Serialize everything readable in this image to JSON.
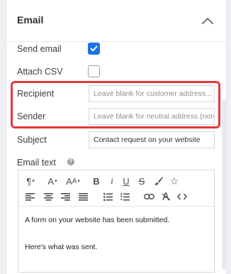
{
  "panel": {
    "title": "Email"
  },
  "fields": {
    "send_email": {
      "label": "Send email",
      "checked": true
    },
    "attach_csv": {
      "label": "Attach CSV",
      "checked": false
    },
    "recipient": {
      "label": "Recipient",
      "placeholder": "Leave blank for customer address..."
    },
    "sender": {
      "label": "Sender",
      "placeholder": "Leave blank for neutral address (norep"
    },
    "subject": {
      "label": "Subject",
      "value": "Contact request on your website"
    },
    "email_text": {
      "label": "Email text"
    }
  },
  "toolbar": {
    "row1": [
      {
        "name": "paragraph-format-button",
        "glyph": "¶",
        "caret": true
      },
      {
        "name": "font-color-button",
        "glyph": "A",
        "caret": true
      },
      {
        "name": "font-size-button",
        "glyph": "AA",
        "caret": true
      },
      {
        "name": "bold-button",
        "glyph": "B"
      },
      {
        "name": "italic-button",
        "glyph": "i"
      },
      {
        "name": "underline-button",
        "glyph": "U"
      },
      {
        "name": "strikethrough-button",
        "glyph": "S"
      },
      {
        "name": "brush-button",
        "glyph": ""
      },
      {
        "name": "star-button",
        "glyph": "☆"
      }
    ]
  },
  "editor": {
    "line1": "A form on your website has been submitted.",
    "line2": "Here's what was sent."
  },
  "colors": {
    "accent": "#1a73e8",
    "highlight_border": "#e4373d"
  }
}
